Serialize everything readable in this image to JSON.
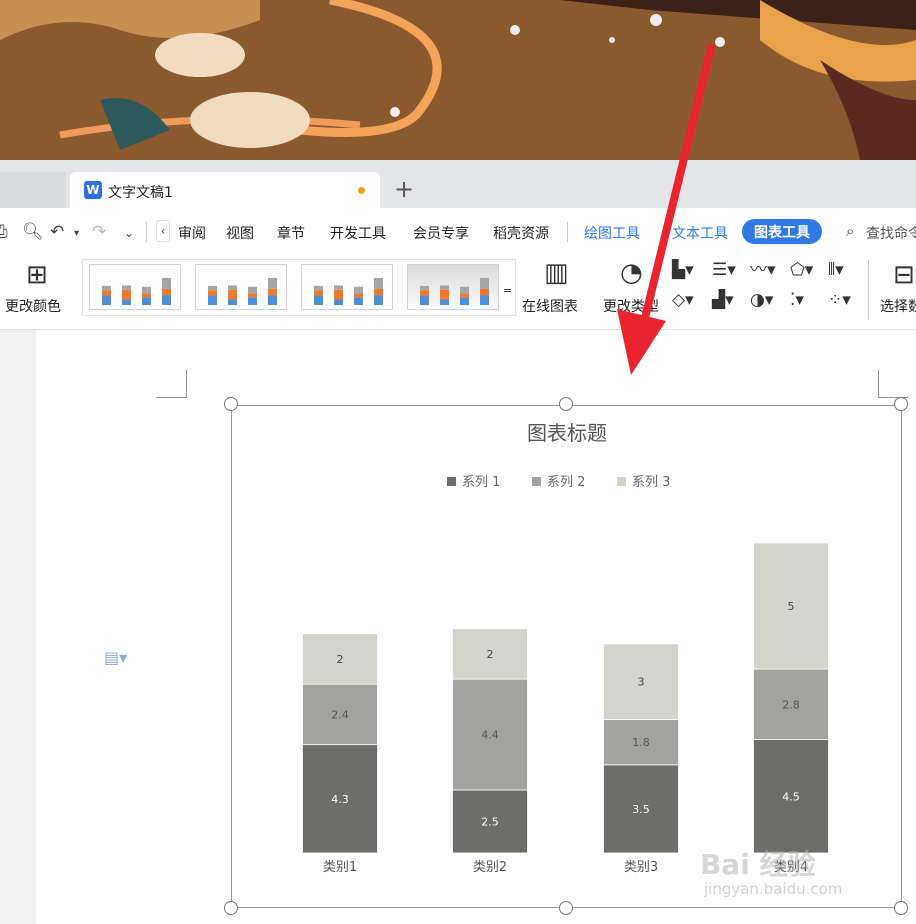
{
  "tabs": {
    "doc_icon": "W",
    "doc_title": "文字文稿1",
    "add_label": "+"
  },
  "menu": {
    "items": [
      "审阅",
      "视图",
      "章节",
      "开发工具",
      "会员专享",
      "稻壳资源"
    ],
    "drawing_tool": "绘图工具",
    "text_tool": "文本工具",
    "chart_tool": "图表工具",
    "search": "查找命令"
  },
  "ribbon": {
    "change_color": "更改颜色",
    "online_chart": "在线图表",
    "change_type": "更改类型",
    "select_data": "选择数据",
    "more": "="
  },
  "colors": {
    "series1": "#6d6e6a",
    "series2": "#a2a39f",
    "series3": "#d4d5ca",
    "accent": "#2f7ae5",
    "arrow": "#e8242e"
  },
  "chart_data": {
    "type": "bar",
    "stacked": true,
    "title": "图表标题",
    "categories": [
      "类别1",
      "类别2",
      "类别3",
      "类别4"
    ],
    "series": [
      {
        "name": "系列 1",
        "values": [
          4.3,
          2.5,
          3.5,
          4.5
        ]
      },
      {
        "name": "系列 2",
        "values": [
          2.4,
          4.4,
          1.8,
          2.8
        ]
      },
      {
        "name": "系列 3",
        "values": [
          2,
          2,
          3,
          5
        ]
      }
    ],
    "legend": "top",
    "grid": false
  },
  "watermark": {
    "brand": "Bai 经验",
    "url": "jingyan.baidu.com"
  }
}
